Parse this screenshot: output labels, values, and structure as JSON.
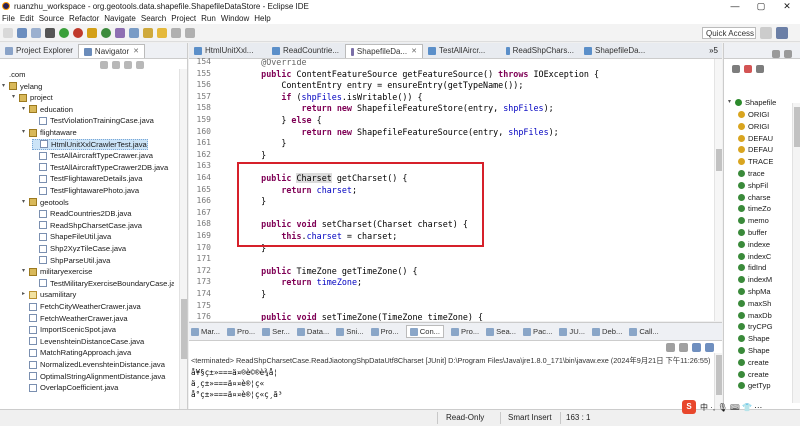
{
  "window": {
    "title": "ruanzhu_workspace - org.geotools.data.shapefile.ShapefileDataStore - Eclipse IDE"
  },
  "window_controls": {
    "min": "—",
    "max": "▢",
    "close": "✕"
  },
  "menu": [
    "File",
    "Edit",
    "Source",
    "Refactor",
    "Navigate",
    "Search",
    "Project",
    "Run",
    "Window",
    "Help"
  ],
  "quick_access": {
    "placeholder": "Quick Access"
  },
  "left_tabs": [
    {
      "label": "Project Explorer"
    },
    {
      "label": "Navigator"
    }
  ],
  "tree": [
    {
      "label": ".com",
      "level": 0,
      "kind": "none"
    },
    {
      "label": "yelang",
      "level": 0,
      "kind": "pkgopen",
      "arrow": "▾"
    },
    {
      "label": "project",
      "level": 1,
      "kind": "pkgopen",
      "arrow": "▾"
    },
    {
      "label": "education",
      "level": 2,
      "kind": "pkgopen",
      "arrow": "▾"
    },
    {
      "label": "TestViolationTrainingCase.java",
      "level": 3,
      "kind": "java"
    },
    {
      "label": "flightaware",
      "level": 2,
      "kind": "pkgopen",
      "arrow": "▾"
    },
    {
      "label": "HtmlUnitXxlCrawlerTest.java",
      "level": 3,
      "kind": "java",
      "selected": true
    },
    {
      "label": "TestAllAircraftTypeCrawer.java",
      "level": 3,
      "kind": "java"
    },
    {
      "label": "TestAllAircraftTypeCrawer2DB.java",
      "level": 3,
      "kind": "java"
    },
    {
      "label": "TestFlightawareDetails.java",
      "level": 3,
      "kind": "java"
    },
    {
      "label": "TestFlightawarePhoto.java",
      "level": 3,
      "kind": "java"
    },
    {
      "label": "geotools",
      "level": 2,
      "kind": "pkgopen",
      "arrow": "▾"
    },
    {
      "label": "ReadCountries2DB.java",
      "level": 3,
      "kind": "java"
    },
    {
      "label": "ReadShpCharsetCase.java",
      "level": 3,
      "kind": "java"
    },
    {
      "label": "ShapeFileUtil.java",
      "level": 3,
      "kind": "java"
    },
    {
      "label": "Shp2XyzTileCase.java",
      "level": 3,
      "kind": "java"
    },
    {
      "label": "ShpParseUtil.java",
      "level": 3,
      "kind": "java"
    },
    {
      "label": "militaryexercise",
      "level": 2,
      "kind": "pkgopen",
      "arrow": "▾"
    },
    {
      "label": "TestMilitaryExerciseBoundaryCase.java",
      "level": 3,
      "kind": "java"
    },
    {
      "label": "usamilitary",
      "level": 2,
      "kind": "pkg",
      "arrow": "▸"
    },
    {
      "label": "FetchCityWeatherCrawer.java",
      "level": 2,
      "kind": "java"
    },
    {
      "label": "FetchWeatherCrawer.java",
      "level": 2,
      "kind": "java"
    },
    {
      "label": "ImportScenicSpot.java",
      "level": 2,
      "kind": "java"
    },
    {
      "label": "LevenshteinDistanceCase.java",
      "level": 2,
      "kind": "java"
    },
    {
      "label": "MatchRatingApproach.java",
      "level": 2,
      "kind": "java"
    },
    {
      "label": "NormalizedLevenshteinDistance.java",
      "level": 2,
      "kind": "java"
    },
    {
      "label": "OptimalStringAlignmentDistance.java",
      "level": 2,
      "kind": "java"
    },
    {
      "label": "OverlapCoefficient.java",
      "level": 2,
      "kind": "java"
    }
  ],
  "editor_tabs": [
    {
      "label": "HtmlUnitXxl..."
    },
    {
      "label": "ReadCountrie..."
    },
    {
      "label": "ShapefileDa...",
      "active": true
    },
    {
      "label": "TestAllAircr..."
    },
    {
      "label": "ReadShpChars..."
    },
    {
      "label": "ShapefileDa..."
    }
  ],
  "editor_overflow": "»5",
  "code_lines": [
    {
      "n": "154",
      "parts": [
        {
          "t": "    @Override",
          "c": "ann"
        }
      ]
    },
    {
      "n": "155",
      "parts": [
        {
          "t": "    "
        },
        {
          "t": "public",
          "c": "kw"
        },
        {
          "t": " ContentFeatureSource getFeatureSource() "
        },
        {
          "t": "throws",
          "c": "kw"
        },
        {
          "t": " IOException {"
        }
      ]
    },
    {
      "n": "156",
      "parts": [
        {
          "t": "        ContentEntry entry = ensureEntry(getTypeName());"
        }
      ]
    },
    {
      "n": "157",
      "parts": [
        {
          "t": "        "
        },
        {
          "t": "if",
          "c": "kw"
        },
        {
          "t": " ("
        },
        {
          "t": "shpFiles",
          "c": "fld"
        },
        {
          "t": ".isWritable()) {"
        }
      ]
    },
    {
      "n": "158",
      "parts": [
        {
          "t": "            "
        },
        {
          "t": "return",
          "c": "kw"
        },
        {
          "t": " "
        },
        {
          "t": "new",
          "c": "kw"
        },
        {
          "t": " ShapefileFeatureStore(entry, "
        },
        {
          "t": "shpFiles",
          "c": "fld"
        },
        {
          "t": ");"
        }
      ]
    },
    {
      "n": "159",
      "parts": [
        {
          "t": "        } "
        },
        {
          "t": "else",
          "c": "kw"
        },
        {
          "t": " {"
        }
      ]
    },
    {
      "n": "160",
      "parts": [
        {
          "t": "            "
        },
        {
          "t": "return",
          "c": "kw"
        },
        {
          "t": " "
        },
        {
          "t": "new",
          "c": "kw"
        },
        {
          "t": " ShapefileFeatureSource(entry, "
        },
        {
          "t": "shpFiles",
          "c": "fld"
        },
        {
          "t": ");"
        }
      ]
    },
    {
      "n": "161",
      "parts": [
        {
          "t": "        }"
        }
      ]
    },
    {
      "n": "162",
      "parts": [
        {
          "t": "    }"
        }
      ]
    },
    {
      "n": "163",
      "parts": [
        {
          "t": ""
        }
      ]
    },
    {
      "n": "164",
      "parts": [
        {
          "t": "    "
        },
        {
          "t": "public",
          "c": "kw"
        },
        {
          "t": " "
        },
        {
          "t": "Charset",
          "c": "hi"
        },
        {
          "t": " getCharset() {"
        }
      ]
    },
    {
      "n": "165",
      "parts": [
        {
          "t": "        "
        },
        {
          "t": "return",
          "c": "kw"
        },
        {
          "t": " "
        },
        {
          "t": "charset",
          "c": "fld"
        },
        {
          "t": ";"
        }
      ]
    },
    {
      "n": "166",
      "parts": [
        {
          "t": "    }"
        }
      ]
    },
    {
      "n": "167",
      "parts": [
        {
          "t": ""
        }
      ]
    },
    {
      "n": "168",
      "parts": [
        {
          "t": "    "
        },
        {
          "t": "public",
          "c": "kw"
        },
        {
          "t": " "
        },
        {
          "t": "void",
          "c": "kw"
        },
        {
          "t": " setCharset(Charset charset) {"
        }
      ]
    },
    {
      "n": "169",
      "parts": [
        {
          "t": "        "
        },
        {
          "t": "this",
          "c": "kw"
        },
        {
          "t": "."
        },
        {
          "t": "charset",
          "c": "fld"
        },
        {
          "t": " = charset;"
        }
      ]
    },
    {
      "n": "170",
      "parts": [
        {
          "t": "    }"
        }
      ]
    },
    {
      "n": "171",
      "parts": [
        {
          "t": ""
        }
      ]
    },
    {
      "n": "172",
      "parts": [
        {
          "t": "    "
        },
        {
          "t": "public",
          "c": "kw"
        },
        {
          "t": " TimeZone getTimeZone() {"
        }
      ]
    },
    {
      "n": "173",
      "parts": [
        {
          "t": "        "
        },
        {
          "t": "return",
          "c": "kw"
        },
        {
          "t": " "
        },
        {
          "t": "timeZone",
          "c": "fld"
        },
        {
          "t": ";"
        }
      ]
    },
    {
      "n": "174",
      "parts": [
        {
          "t": "    }"
        }
      ]
    },
    {
      "n": "175",
      "parts": [
        {
          "t": ""
        }
      ]
    },
    {
      "n": "176",
      "parts": [
        {
          "t": "    "
        },
        {
          "t": "public",
          "c": "kw"
        },
        {
          "t": " "
        },
        {
          "t": "void",
          "c": "kw"
        },
        {
          "t": " setTimeZone(TimeZone timeZone) {"
        }
      ]
    }
  ],
  "outline": {
    "title": "Shapefile",
    "items": [
      "ORIGI",
      "ORIGI",
      "DEFAU",
      "DEFAU",
      "TRACE",
      "trace",
      "shpFil",
      "charse",
      "timeZo",
      "memo",
      "buffer",
      "indexe",
      "indexC",
      "fidInd",
      "indexM",
      "shpMa",
      "maxSh",
      "maxDb",
      "tryCPG",
      "Shape",
      "Shape",
      "create",
      "create",
      "getTyp"
    ],
    "colors": [
      "#d9a520",
      "#d9a520",
      "#d9a520",
      "#d9a520",
      "#d9a520",
      "#3a8a3a",
      "#3a8a3a",
      "#3a8a3a",
      "#3a8a3a",
      "#3a8a3a",
      "#3a8a3a",
      "#3a8a3a",
      "#3a8a3a",
      "#3a8a3a",
      "#3a8a3a",
      "#3a8a3a",
      "#3a8a3a",
      "#3a8a3a",
      "#3a8a3a",
      "#3a8a3a",
      "#3a8a3a",
      "#3a8a3a",
      "#3a8a3a",
      "#3a8a3a"
    ]
  },
  "bottom_tabs": [
    "Mar...",
    "Pro...",
    "Ser...",
    "Data...",
    "Sni...",
    "Pro...",
    "Con...",
    "Pro...",
    "Sea...",
    "Pac...",
    "JU...",
    "Deb...",
    "Call..."
  ],
  "console": {
    "header": "<terminated> ReadShpCharsetCase.ReadJiaotongShpDataUtf8Charset [JUnit] D:\\Program Files\\Java\\jre1.8.0_171\\bin\\javaw.exe (2024年9月21日 下午11:26:55)",
    "lines": [
      "å¥§ç±»===ä¤®è©®è¾å¦",
      "ä¸ç±»===ä¤¤è®¦ç«",
      "å°ç±»===ä¤¤è®¦ç«ç¸ã³"
    ]
  },
  "status": {
    "mode": "Read-Only",
    "insert": "Smart Insert",
    "position": "163 : 1"
  },
  "ime": {
    "logo": "S",
    "label": "中 ·, 🎙 ⌨ 👕 ⋯"
  }
}
